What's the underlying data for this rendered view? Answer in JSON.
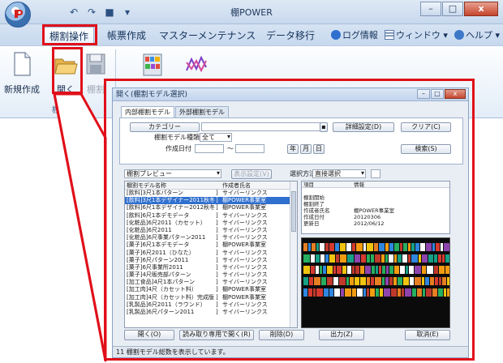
{
  "window": {
    "title": "棚POWER",
    "controls": {
      "minimize": "–",
      "maximize": "□",
      "close": "x"
    }
  },
  "qat": {
    "undo": "↶",
    "redo": "↷",
    "save": "■",
    "dropdown": "▾"
  },
  "ribbon_tabs": [
    {
      "label": "棚割操作",
      "active": true
    },
    {
      "label": "帳票作成",
      "active": false
    },
    {
      "label": "マスターメンテナンス",
      "active": false
    },
    {
      "label": "データ移行",
      "active": false
    }
  ],
  "right_menu": [
    {
      "label": "ログ情報"
    },
    {
      "label": "ウィンドウ ▾"
    },
    {
      "label": "ヘルプ ▾"
    }
  ],
  "ribbon": {
    "new_label": "新規作成",
    "open_label": "開く",
    "save_partial": "棚割",
    "group_label": "棚割操"
  },
  "colors": {
    "highlight": "#e0101a",
    "selection": "#2f6fce",
    "accent": "#2e5d98"
  },
  "dialog": {
    "title": "開く(棚割モデル選択)",
    "tabs": [
      {
        "label": "内部棚割モデル",
        "active": true
      },
      {
        "label": "外部棚割モデル",
        "active": false
      }
    ],
    "category_btn": "カテゴリー",
    "detail_btn": "詳細設定(D)",
    "clear_btn": "クリア(C)",
    "model_type_label": "棚割モデル種類",
    "model_type_value": "全て",
    "date_label": "作成日付",
    "date_sep": "～",
    "year_btn": "年",
    "month_btn": "月",
    "day_btn": "日",
    "search_btn": "検索(S)",
    "preview_select": "棚割プレビュー",
    "disp_btn": "表示設定(V)",
    "select_mode_label": "選択方法",
    "select_mode_value": "直接選択",
    "list_headers": [
      "棚割モデル名称",
      "作成者氏名"
    ],
    "list_rows": [
      {
        "name": "[飲料]3尺1本パターン",
        "author": "サイバーリンクス",
        "selected": false
      },
      {
        "name": "[飲料]3尺1本デザイナー2011秋冬",
        "author": "棚POWER事業室",
        "selected": true
      },
      {
        "name": "[飲料]6尺1本デザイナー2012秋冬",
        "author": "棚POWER事業室",
        "selected": false
      },
      {
        "name": "[飲料]6尺1本デモデータ",
        "author": "サイバーリンクス",
        "selected": false
      },
      {
        "name": "[化粧品]6尺2011（カセット）",
        "author": "サイバーリンクス",
        "selected": false
      },
      {
        "name": "[化粧品]6尺2011",
        "author": "サイバーリンクス",
        "selected": false
      },
      {
        "name": "[化粧品]6尺事業パターン2011",
        "author": "サイバーリンクス",
        "selected": false
      },
      {
        "name": "[菓子]6尺1本デモデータ",
        "author": "棚POWER事業室",
        "selected": false
      },
      {
        "name": "[菓子]6尺2011（ひなた）",
        "author": "サイバーリンクス",
        "selected": false
      },
      {
        "name": "[菓子]6尺パターン2011",
        "author": "サイバーリンクス",
        "selected": false
      },
      {
        "name": "[菓子]6尺事業所2011",
        "author": "サイバーリンクス",
        "selected": false
      },
      {
        "name": "[菓子]4尺販売部パターン",
        "author": "サイバーリンクス",
        "selected": false
      },
      {
        "name": "[加工食品]4尺1本パターン",
        "author": "サイバーリンクス",
        "selected": false
      },
      {
        "name": "[加工肉]4尺（カセット料）",
        "author": "棚POWER事業室",
        "selected": false
      },
      {
        "name": "[加工肉]4尺（カセット料）完成版",
        "author": "棚POWER事業室",
        "selected": false
      },
      {
        "name": "[乳製品]6尺2011（ラウンド）",
        "author": "サイバーリンクス",
        "selected": false
      },
      {
        "name": "[乳製品]6尺パターン2011",
        "author": "サイバーリンクス",
        "selected": false
      }
    ],
    "prop_headers": [
      "項目",
      "情報"
    ],
    "props": [
      {
        "key": "棚割開始",
        "val": ""
      },
      {
        "key": "棚割終了",
        "val": ""
      },
      {
        "key": "作成者氏名",
        "val": "棚POWER事業室"
      },
      {
        "key": "作成日付",
        "val": "20120306"
      },
      {
        "key": "更新日",
        "val": "2012/06/12"
      }
    ],
    "bottom_buttons": {
      "open": "開く(O)",
      "readonly": "読み取り専用で開く(R)",
      "delete": "削除(D)",
      "print": "出力(Z)",
      "cancel": "取消(E)"
    },
    "status": "11 棚割モデル総数を表示しています。"
  }
}
